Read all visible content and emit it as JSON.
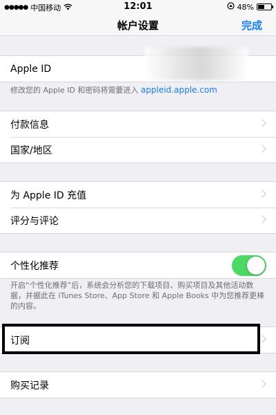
{
  "status_bar": {
    "carrier": "中国移动",
    "time": "12:01",
    "battery": "48%",
    "battery_level": 0.48
  },
  "nav": {
    "title": "帐户设置",
    "done": "完成"
  },
  "apple_id": {
    "label": "Apple ID",
    "note": "修改您的 Apple ID 和密码将需要进入",
    "link": "appleid.apple.com"
  },
  "group1": {
    "payment": "付款信息",
    "region": "国家/地区"
  },
  "group2": {
    "topup": "为 Apple ID 充值",
    "ratings": "评分与评论"
  },
  "personalized": {
    "label": "个性化推荐",
    "toggle_on": true,
    "note": "开启“个性化推荐”后，系统会分析您的下载项目、购买项目及其他活动数据，并据此在 iTunes Store、App Store 和 Apple Books 中为您推荐更棒的内容。"
  },
  "subscriptions": "订阅",
  "purchase_history": "购买记录",
  "colors": {
    "accent": "#157efb",
    "toggle_green": "#4cd964",
    "background": "#efeff4"
  }
}
